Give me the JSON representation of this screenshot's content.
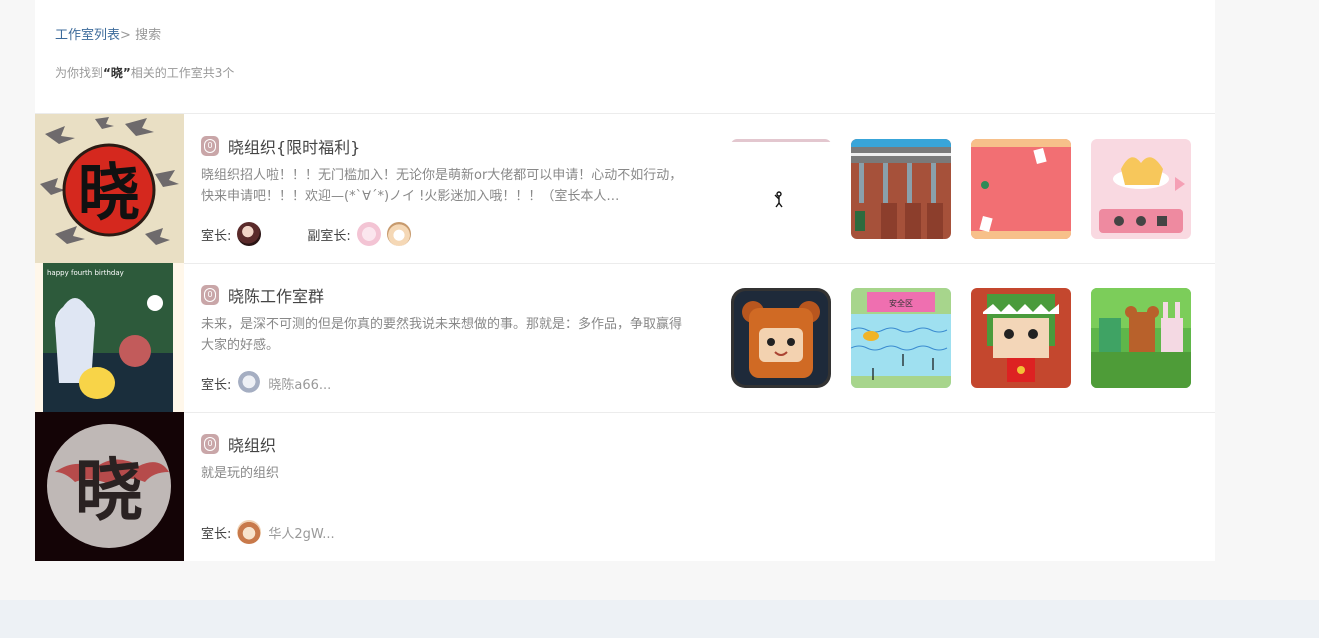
{
  "breadcrumb": {
    "link": "工作室列表",
    "sep": ">",
    "current": "搜索"
  },
  "result": {
    "prefix": "为你找到",
    "keyword": "“晓”",
    "suffix": "相关的工作室共3个"
  },
  "labels": {
    "owner": "室长:",
    "deputy": "副室长:",
    "badge": "0"
  },
  "studios": [
    {
      "title": "晓组织{限时福利}",
      "desc": "晓组织招人啦！！！无门槛加入！无论你是萌新or大佬都可以申请！心动不如行动，快来申请吧！！！欢迎—(*ˋ∀ˊ*)ノイ !火影迷加入哦！！！（室长本人…",
      "owner_name": "",
      "cover_char": "晓"
    },
    {
      "title": "晓陈工作室群",
      "desc": "未来，是深不可测的但是你真的要然我说未来想做的事。那就是：多作品，争取赢得大家的好感。",
      "owner_name": "晓陈a66...",
      "cover_text": "happy fourth birthday"
    },
    {
      "title": "晓组织",
      "desc": "就是玩的组织",
      "owner_name": "华人2gW...",
      "cover_char": "晓"
    }
  ],
  "thumb_text": {
    "safe_zone": "安全区"
  }
}
